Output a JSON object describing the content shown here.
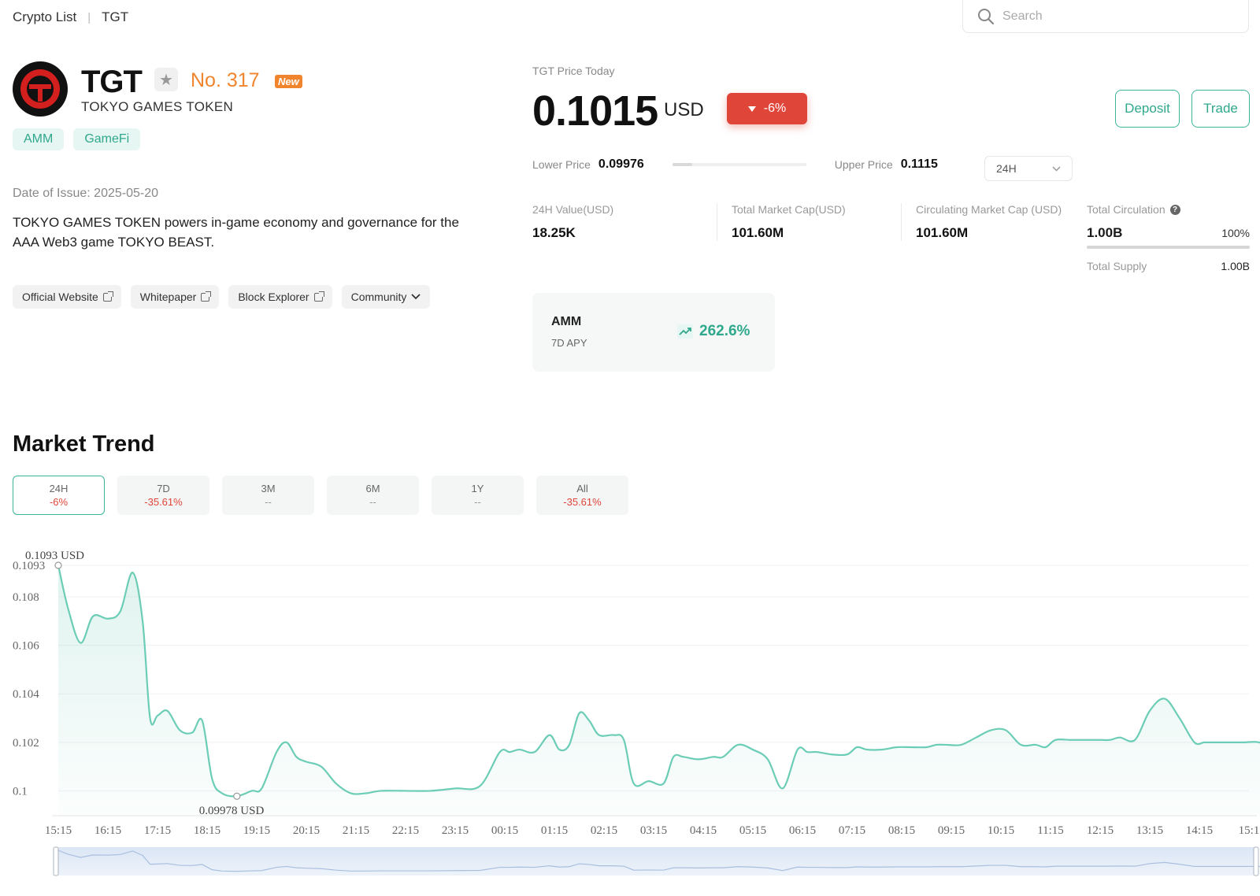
{
  "breadcrumb": {
    "root": "Crypto List",
    "current": "TGT"
  },
  "search": {
    "placeholder": "Search"
  },
  "token": {
    "symbol": "TGT",
    "rank": "No. 317",
    "new_badge": "New",
    "name": "TOKYO GAMES TOKEN",
    "tags": [
      "AMM",
      "GameFi"
    ],
    "issue_date": "Date of Issue: 2025-05-20",
    "description": "TOKYO GAMES TOKEN powers in-game economy and governance for the AAA Web3 game TOKYO BEAST.",
    "links": [
      "Official Website",
      "Whitepaper",
      "Block Explorer"
    ],
    "community_label": "Community"
  },
  "price": {
    "label": "TGT Price Today",
    "value": "0.1015",
    "unit": "USD",
    "change": "-6%",
    "lower_label": "Lower Price",
    "lower_value": "0.09976",
    "upper_label": "Upper Price",
    "upper_value": "0.1115",
    "range_position": 0.15,
    "period": "24H"
  },
  "actions": {
    "deposit": "Deposit",
    "trade": "Trade"
  },
  "stats": [
    {
      "label": "24H Value(USD)",
      "value": "18.25K"
    },
    {
      "label": "Total Market Cap(USD)",
      "value": "101.60M"
    },
    {
      "label": "Circulating Market Cap (USD)",
      "value": "101.60M"
    }
  ],
  "circulation": {
    "label": "Total Circulation",
    "value": "1.00B",
    "percent": "100%",
    "fraction": 1.0,
    "supply_label": "Total Supply",
    "supply_value": "1.00B"
  },
  "amm": {
    "title": "AMM",
    "subtitle": "7D APY",
    "apy": "262.6%"
  },
  "market_trend": {
    "title": "Market Trend",
    "periods": [
      {
        "label": "24H",
        "change": "-6%",
        "active": true
      },
      {
        "label": "7D",
        "change": "-35.61%",
        "active": false
      },
      {
        "label": "3M",
        "change": "--",
        "active": false
      },
      {
        "label": "6M",
        "change": "--",
        "active": false
      },
      {
        "label": "1Y",
        "change": "--",
        "active": false
      },
      {
        "label": "All",
        "change": "-35.61%",
        "active": false
      }
    ]
  },
  "colors": {
    "accent": "#3ab59a",
    "negative": "#e0453a",
    "orange": "#f0852d"
  },
  "chart_data": {
    "type": "area",
    "y_ticks": [
      "0.1093",
      "0.108",
      "0.106",
      "0.104",
      "0.102",
      "0.1"
    ],
    "x_ticks": [
      "15:15",
      "16:15",
      "17:15",
      "18:15",
      "19:15",
      "20:15",
      "21:15",
      "22:15",
      "23:15",
      "00:15",
      "01:15",
      "02:15",
      "03:15",
      "04:15",
      "05:15",
      "06:15",
      "07:15",
      "08:15",
      "09:15",
      "10:15",
      "11:15",
      "12:15",
      "13:15",
      "14:15",
      "15:1"
    ],
    "ylim": [
      0.0993,
      0.1093
    ],
    "max_label": "0.1093 USD",
    "min_label": "0.09978 USD",
    "series": [
      {
        "x": [
          0,
          0.2,
          0.45,
          0.7,
          1.0,
          1.25,
          1.5,
          1.7,
          1.85,
          2.0,
          2.2,
          2.45,
          2.7,
          2.9,
          3.1,
          3.3,
          3.6,
          3.9,
          4.1,
          4.4,
          4.6,
          4.8,
          5.0,
          5.3,
          5.6,
          5.9,
          6.2,
          6.5,
          7.0,
          7.5,
          8.0,
          8.5,
          8.9,
          9.1,
          9.3,
          9.6,
          9.9,
          10.1,
          10.3,
          10.5,
          10.7,
          10.9,
          11.2,
          11.4,
          11.6,
          11.9,
          12.2,
          12.4,
          12.6,
          12.9,
          13.2,
          13.4,
          13.7,
          14.0,
          14.3,
          14.6,
          14.9,
          15.1,
          15.3,
          15.6,
          15.9,
          16.1,
          16.3,
          16.6,
          16.9,
          17.2,
          17.5,
          17.7,
          17.9,
          18.2,
          18.5,
          18.8,
          19.1,
          19.4,
          19.7,
          19.9,
          20.1,
          20.4,
          20.7,
          21.0,
          21.2,
          21.4,
          21.7,
          22.0,
          22.3,
          22.6,
          22.9,
          23.1,
          23.3,
          23.6,
          23.9,
          24.2,
          24.5
        ],
        "y": [
          0.1093,
          0.1075,
          0.1061,
          0.1072,
          0.1071,
          0.1074,
          0.109,
          0.107,
          0.103,
          0.1031,
          0.1033,
          0.1025,
          0.1024,
          0.1029,
          0.1005,
          0.0999,
          0.09978,
          0.1,
          0.1001,
          0.1016,
          0.102,
          0.1014,
          0.1012,
          0.101,
          0.1003,
          0.0999,
          0.0999,
          0.1,
          0.1,
          0.1,
          0.1001,
          0.1002,
          0.1016,
          0.1016,
          0.1017,
          0.1016,
          0.1023,
          0.1017,
          0.1019,
          0.1032,
          0.1029,
          0.1023,
          0.1023,
          0.1021,
          0.1003,
          0.1004,
          0.1003,
          0.1014,
          0.1014,
          0.1013,
          0.1014,
          0.1014,
          0.1019,
          0.1017,
          0.1013,
          0.1001,
          0.1017,
          0.1016,
          0.1016,
          0.1015,
          0.1015,
          0.1018,
          0.1017,
          0.1017,
          0.1018,
          0.1018,
          0.1018,
          0.1019,
          0.1019,
          0.1019,
          0.1022,
          0.1025,
          0.1025,
          0.1019,
          0.1019,
          0.1018,
          0.1021,
          0.1021,
          0.1021,
          0.1021,
          0.1021,
          0.1022,
          0.1021,
          0.1033,
          0.1038,
          0.103,
          0.102,
          0.102,
          0.102,
          0.102,
          0.102,
          0.102,
          0.1017
        ]
      }
    ]
  }
}
